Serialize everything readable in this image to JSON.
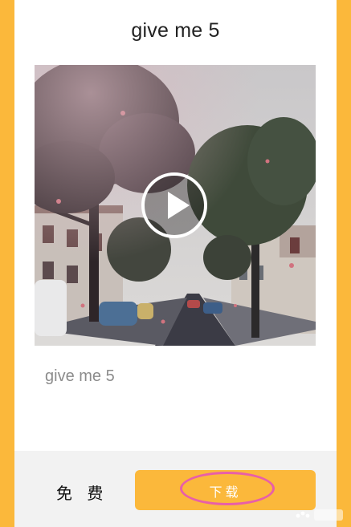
{
  "header": {
    "title": "give me 5"
  },
  "video": {
    "play_icon": "play-icon",
    "accent": "#ffffff"
  },
  "caption": "give me 5",
  "footer": {
    "price_label": "免 费",
    "download_label": "下载",
    "button_color": "#fbb83b",
    "highlight_color": "#e85fa8"
  },
  "theme": {
    "frame_color": "#fbb83b",
    "card_color": "#ffffff",
    "footer_color": "#f2f2f2"
  }
}
